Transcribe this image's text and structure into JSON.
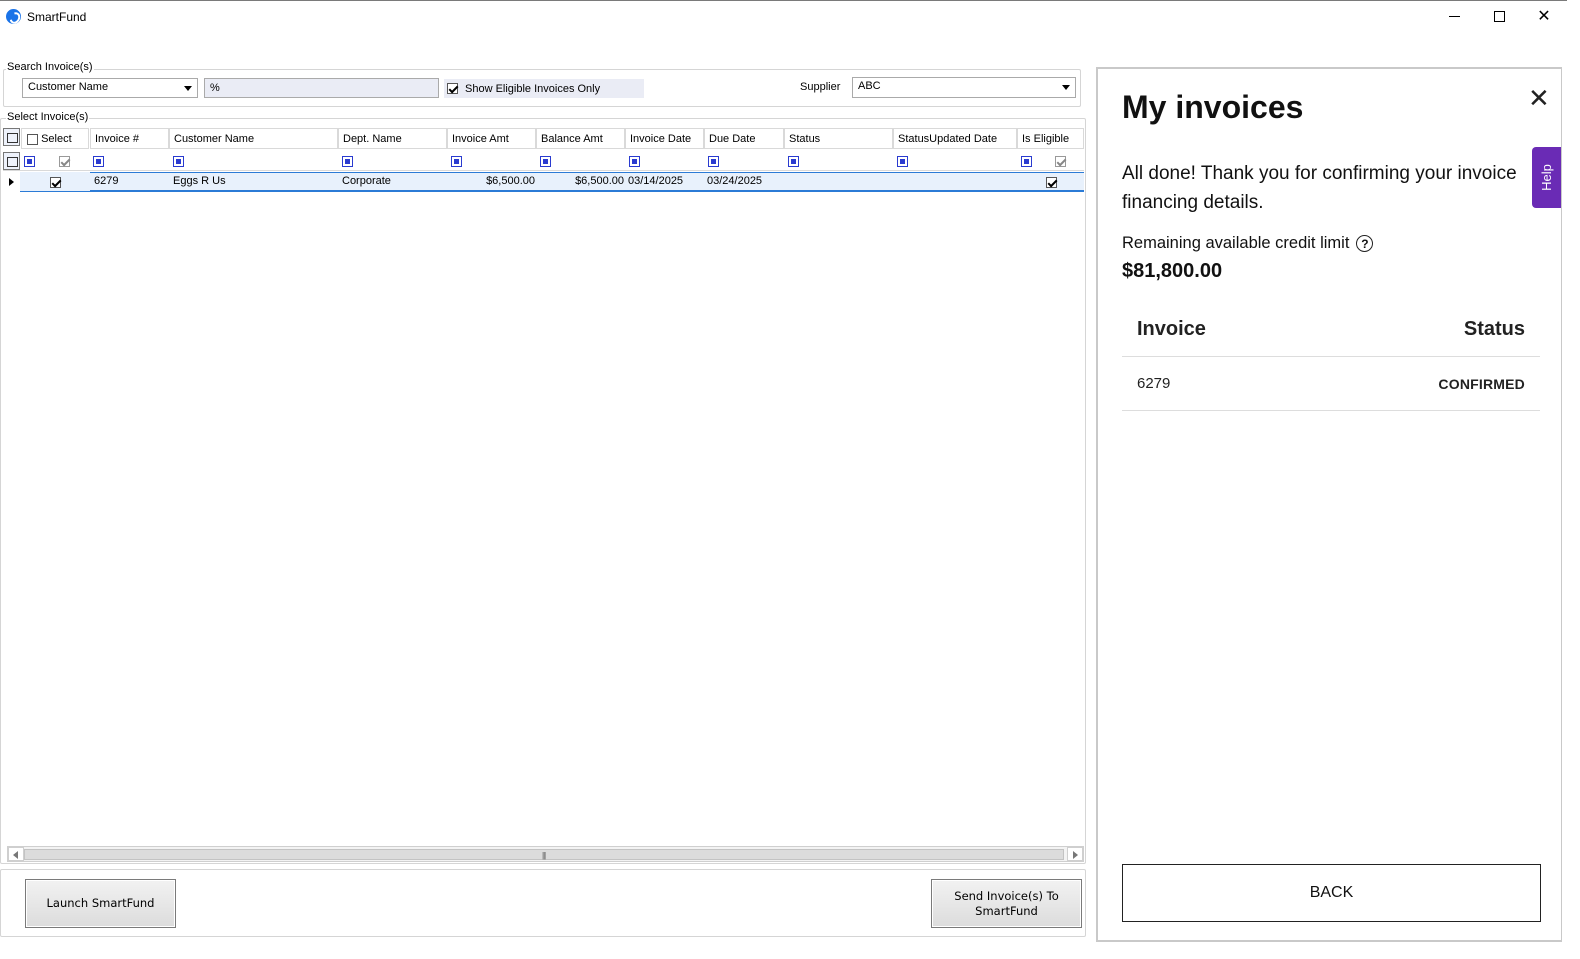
{
  "window": {
    "title": "SmartFund"
  },
  "search": {
    "group_label": "Search Invoice(s)",
    "field_select": "Customer Name",
    "query": "%",
    "show_eligible_label": "Show Eligible Invoices Only",
    "show_eligible_checked": true,
    "supplier_label": "Supplier",
    "supplier_value": "ABC"
  },
  "grid": {
    "group_label": "Select Invoice(s)",
    "columns": [
      "Select",
      "Invoice #",
      "Customer Name",
      "Dept. Name",
      "Invoice Amt",
      "Balance Amt",
      "Invoice Date",
      "Due Date",
      "Status",
      "StatusUpdated Date",
      "Is Eligible"
    ],
    "rows": [
      {
        "selected": true,
        "invoice": "6279",
        "customer": "Eggs R Us",
        "dept": "Corporate",
        "invoice_amt": "$6,500.00",
        "balance_amt": "$6,500.00",
        "invoice_date": "03/14/2025",
        "due_date": "03/24/2025",
        "status": "",
        "status_updated": "",
        "is_eligible": true
      }
    ]
  },
  "buttons": {
    "launch": "Launch SmartFund",
    "send": "Send Invoice(s) To SmartFund"
  },
  "panel": {
    "title": "My invoices",
    "help": "Help",
    "message": "All done! Thank you for confirming your invoice financing details.",
    "credit_label": "Remaining available credit limit",
    "credit_value": "$81,800.00",
    "table_headers": {
      "invoice": "Invoice",
      "status": "Status"
    },
    "rows": [
      {
        "invoice": "6279",
        "status": "CONFIRMED"
      }
    ],
    "back": "BACK"
  },
  "colors": {
    "help_tab": "#6a2bb5",
    "selection": "#2b7bd6",
    "filter_icon": "#2a3bd0"
  }
}
